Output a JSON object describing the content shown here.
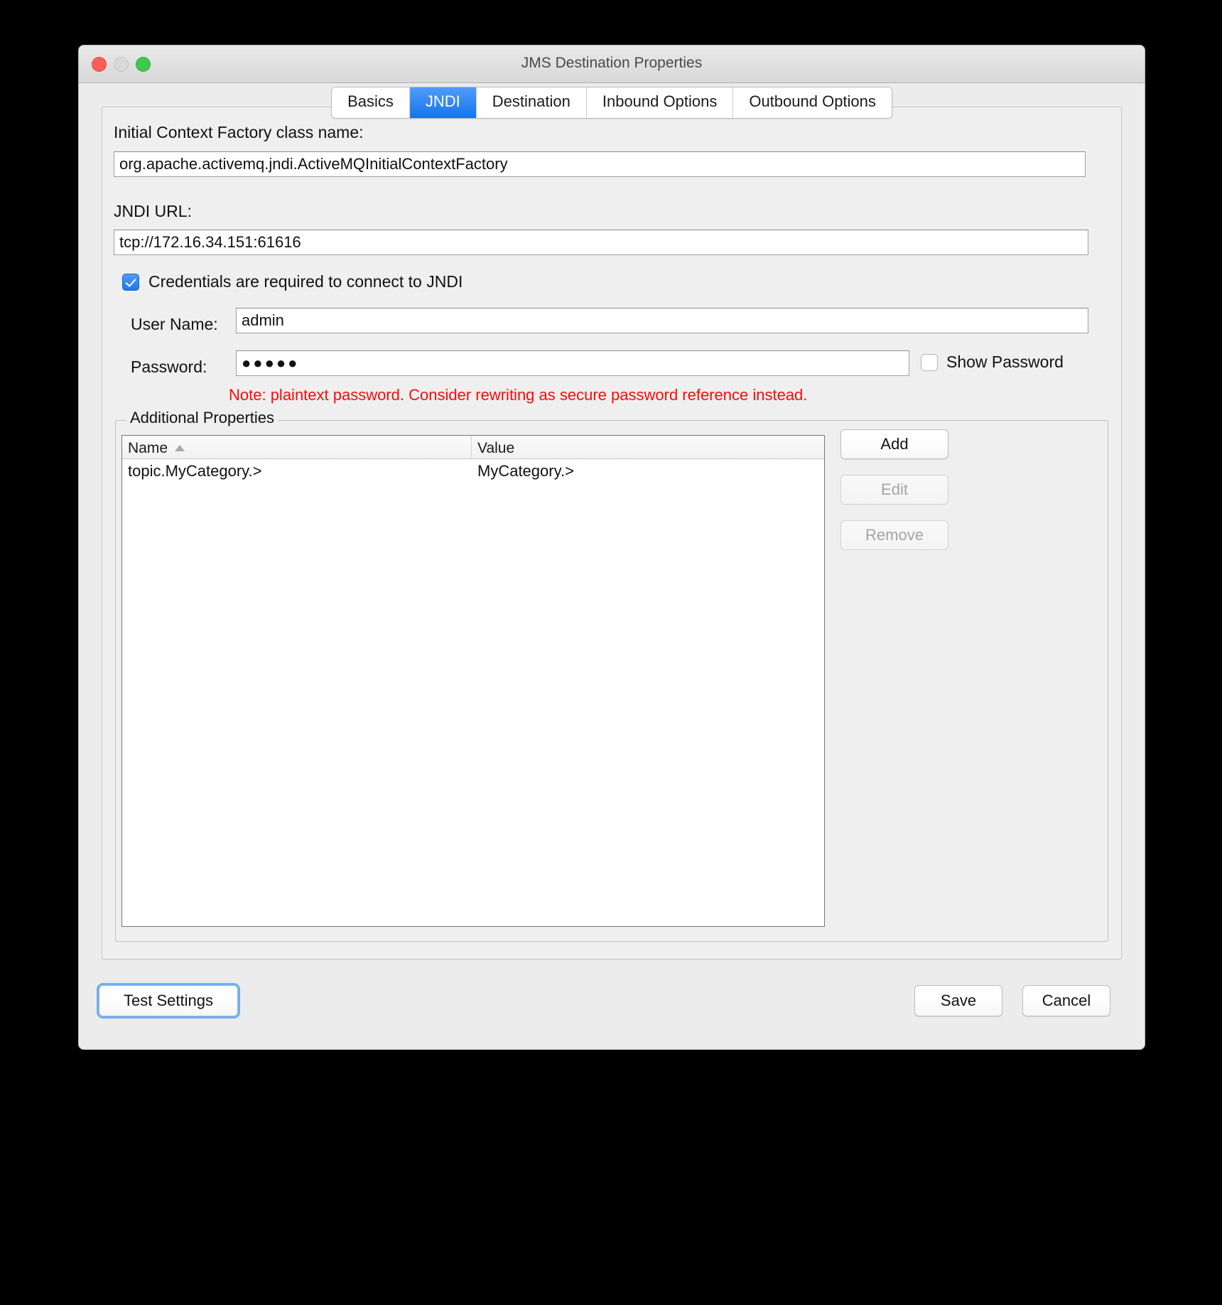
{
  "window": {
    "title": "JMS Destination Properties",
    "traffic_lights": [
      "close",
      "minimize",
      "zoom"
    ]
  },
  "tabs": [
    {
      "label": "Basics",
      "active": false
    },
    {
      "label": "JNDI",
      "active": true
    },
    {
      "label": "Destination",
      "active": false
    },
    {
      "label": "Inbound Options",
      "active": false
    },
    {
      "label": "Outbound Options",
      "active": false
    }
  ],
  "form": {
    "initial_context_factory_label": "Initial Context Factory class name:",
    "initial_context_factory_value": "org.apache.activemq.jndi.ActiveMQInitialContextFactory",
    "jndi_url_label": "JNDI URL:",
    "jndi_url_value": "tcp://172.16.34.151:61616",
    "credentials_checkbox_label": "Credentials are required to connect to JNDI",
    "credentials_checked": true,
    "user_name_label": "User Name:",
    "user_name_value": "admin",
    "password_label": "Password:",
    "password_value": "●●●●●",
    "show_password_label": "Show Password",
    "show_password_checked": false,
    "password_note": "Note: plaintext password. Consider rewriting as secure password reference instead.",
    "note_color": "#fb0a0a"
  },
  "additional_properties": {
    "group_title": "Additional Properties",
    "columns": [
      "Name",
      "Value"
    ],
    "sort_column": "Name",
    "sort_direction": "ascending",
    "rows": [
      {
        "name": "topic.MyCategory.>",
        "value": "MyCategory.>"
      }
    ],
    "buttons": [
      {
        "label": "Add",
        "enabled": true
      },
      {
        "label": "Edit",
        "enabled": false
      },
      {
        "label": "Remove",
        "enabled": false
      }
    ]
  },
  "footer": {
    "test_settings_label": "Test Settings",
    "save_label": "Save",
    "cancel_label": "Cancel"
  },
  "colors": {
    "accent": "#1673ef",
    "warning": "#fb0a0a",
    "window_bg": "#ececec",
    "panel_bg": "#efefef"
  }
}
